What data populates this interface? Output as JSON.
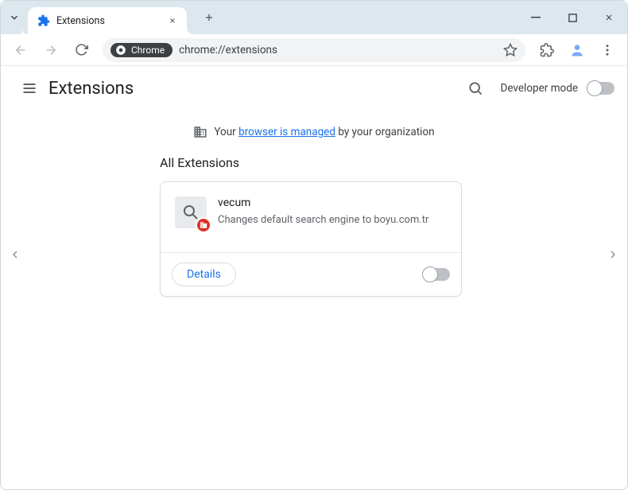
{
  "titlebar": {
    "tab_title": "Extensions"
  },
  "omnibox": {
    "chip_label": "Chrome",
    "url": "chrome://extensions"
  },
  "header": {
    "title": "Extensions",
    "developer_mode_label": "Developer mode"
  },
  "managed_banner": {
    "prefix": "Your ",
    "link": "browser is managed",
    "suffix": " by your organization"
  },
  "section": {
    "title": "All Extensions"
  },
  "extension": {
    "name": "vecum",
    "description": "Changes default search engine to boyu.com.tr",
    "details_label": "Details"
  }
}
